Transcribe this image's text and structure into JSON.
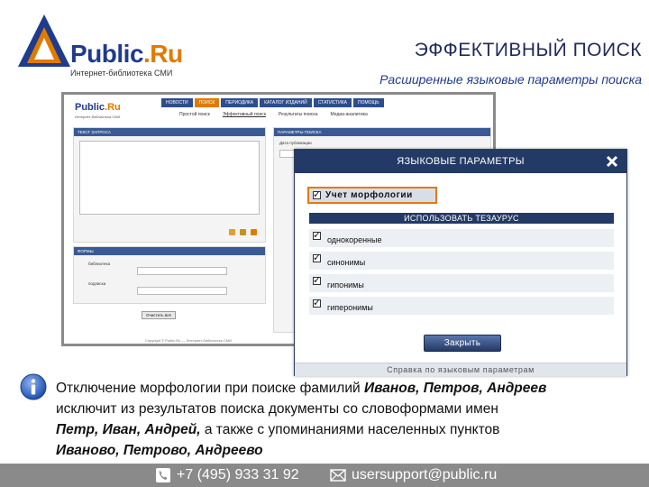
{
  "logo": {
    "brand_main": "Public",
    "brand_accent": ".Ru",
    "tagline": "Интернет-библиотека СМИ"
  },
  "slide": {
    "title": "ЭФФЕКТИВНЫЙ ПОИСК",
    "subtitle": "Расширенные языковые параметры поиска"
  },
  "screenshot": {
    "nav": [
      "НОВОСТИ",
      "ПОИСК",
      "ПЕРИОДИКА",
      "КАТАЛОГ ИЗДАНИЙ",
      "СТАТИСТИКА",
      "ПОМОЩЬ"
    ],
    "subnav": [
      "Простой поиск",
      "Эффективный поиск",
      "Результаты поиска",
      "Медиа-аналитика"
    ],
    "query_panel_title": "ТЕКСТ ЗАПРОСА",
    "params_panel_title": "ПАРАМЕТРЫ ПОИСКА",
    "date_label": "Дата публикации",
    "forms_panel_title": "ФОРМЫ",
    "form_option_1": "библиотека",
    "form_option_2": "подписка",
    "clear_button": "Очистить всё",
    "footer_text": "Copyright © Public.Ru — Интернет-библиотека СМИ"
  },
  "modal": {
    "title": "ЯЗЫКОВЫЕ ПАРАМЕТРЫ",
    "morphology_label": "Учет морфологии",
    "morphology_checked": true,
    "thesaurus_header": "ИСПОЛЬЗОВАТЬ ТЕЗАУРУС",
    "options": [
      {
        "label": "однокоренные",
        "checked": true
      },
      {
        "label": "синонимы",
        "checked": true
      },
      {
        "label": "гипонимы",
        "checked": true
      },
      {
        "label": "гиперонимы",
        "checked": true
      }
    ],
    "close_button": "Закрыть",
    "help_link": "Справка по языковым параметрам"
  },
  "explanation": {
    "line1_plain": "Отключение морфологии при поиске фамилий ",
    "line1_bold": "Иванов, Петров, Андреев",
    "line2_plain": "исключит из результатов поиска документы со словоформами имен",
    "line3_bold": "Петр, Иван, Андрей,",
    "line3_plain": " а также  с упоминаниями населенных пунктов",
    "line4_bold": "Иваново, Петрово, Андреево"
  },
  "footer": {
    "phone": "+7 (495) 933 31 92",
    "email": "usersupport@public.ru"
  },
  "colors": {
    "navy": "#243a66",
    "orange_highlight": "#e37a0f",
    "footer_gray": "#8a8a8a"
  }
}
